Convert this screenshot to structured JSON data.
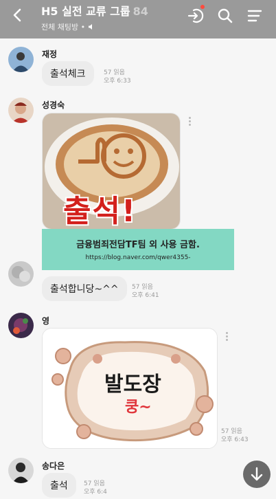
{
  "header": {
    "title": "H5 실전 교류 그룹",
    "member_count": "84",
    "subtitle": "전체 채팅방 •",
    "icons": [
      "back-icon",
      "enter-icon",
      "search-icon",
      "menu-icon"
    ],
    "alert_color": "#ff4a3d"
  },
  "messages": [
    {
      "sender": "재정",
      "text": "출석체크",
      "read": "57 읽음",
      "time": "오후 6:33"
    },
    {
      "sender": "성경숙",
      "image_caption": "출석!",
      "image_type": "thumbs-up latte"
    },
    {
      "sender": "",
      "text": "출석합니당~^^",
      "read": "57 읽음",
      "time": "오후 6:41"
    },
    {
      "sender": "영",
      "image_caption": "발도장",
      "image_caption2": "쿵~",
      "read": "57 읽음",
      "time": "오후 6:43"
    },
    {
      "sender": "송다은",
      "text": "출석",
      "read": "57 읽음",
      "time": "오후 6:4"
    }
  ],
  "watermark": {
    "text": "금융범죄전담TF팀 외 사용 금함.",
    "url": "https://blog.naver.com/qwer4355-"
  },
  "colors": {
    "header_bg": "#9a9a9a",
    "bubble_bg": "#ececec",
    "overlay_bg": "#83d8c3"
  }
}
